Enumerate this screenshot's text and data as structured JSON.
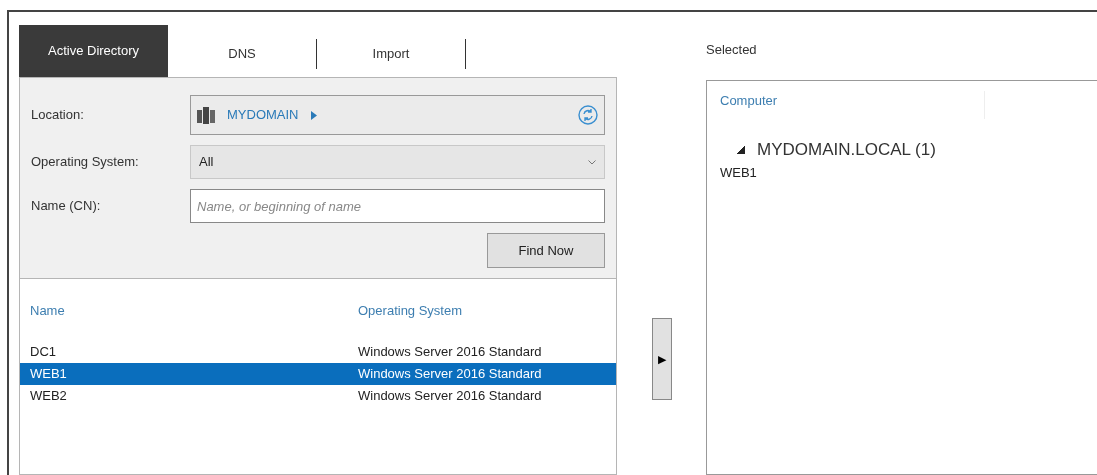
{
  "tabs": [
    {
      "label": "Active Directory",
      "selected": true
    },
    {
      "label": "DNS",
      "selected": false
    },
    {
      "label": "Import",
      "selected": false
    }
  ],
  "filters": {
    "location_label": "Location:",
    "location": "MYDOMAIN",
    "os_label": "Operating System:",
    "os_value": "All",
    "name_label": "Name (CN):",
    "name_placeholder": "Name, or beginning of name",
    "find_button": "Find Now"
  },
  "results": {
    "columns": [
      "Name",
      "Operating System"
    ],
    "rows": [
      {
        "name": "DC1",
        "os": "Windows Server 2016 Standard",
        "selected": false
      },
      {
        "name": "WEB1",
        "os": "Windows Server 2016 Standard",
        "selected": true
      },
      {
        "name": "WEB2",
        "os": "Windows Server 2016 Standard",
        "selected": false
      }
    ]
  },
  "move_button": "▶",
  "selected_panel": {
    "title": "Selected",
    "column": "Computer",
    "groups": [
      {
        "label": "MYDOMAIN.LOCAL (1)",
        "expanded": true,
        "children": [
          {
            "label": "WEB1"
          }
        ]
      }
    ]
  }
}
